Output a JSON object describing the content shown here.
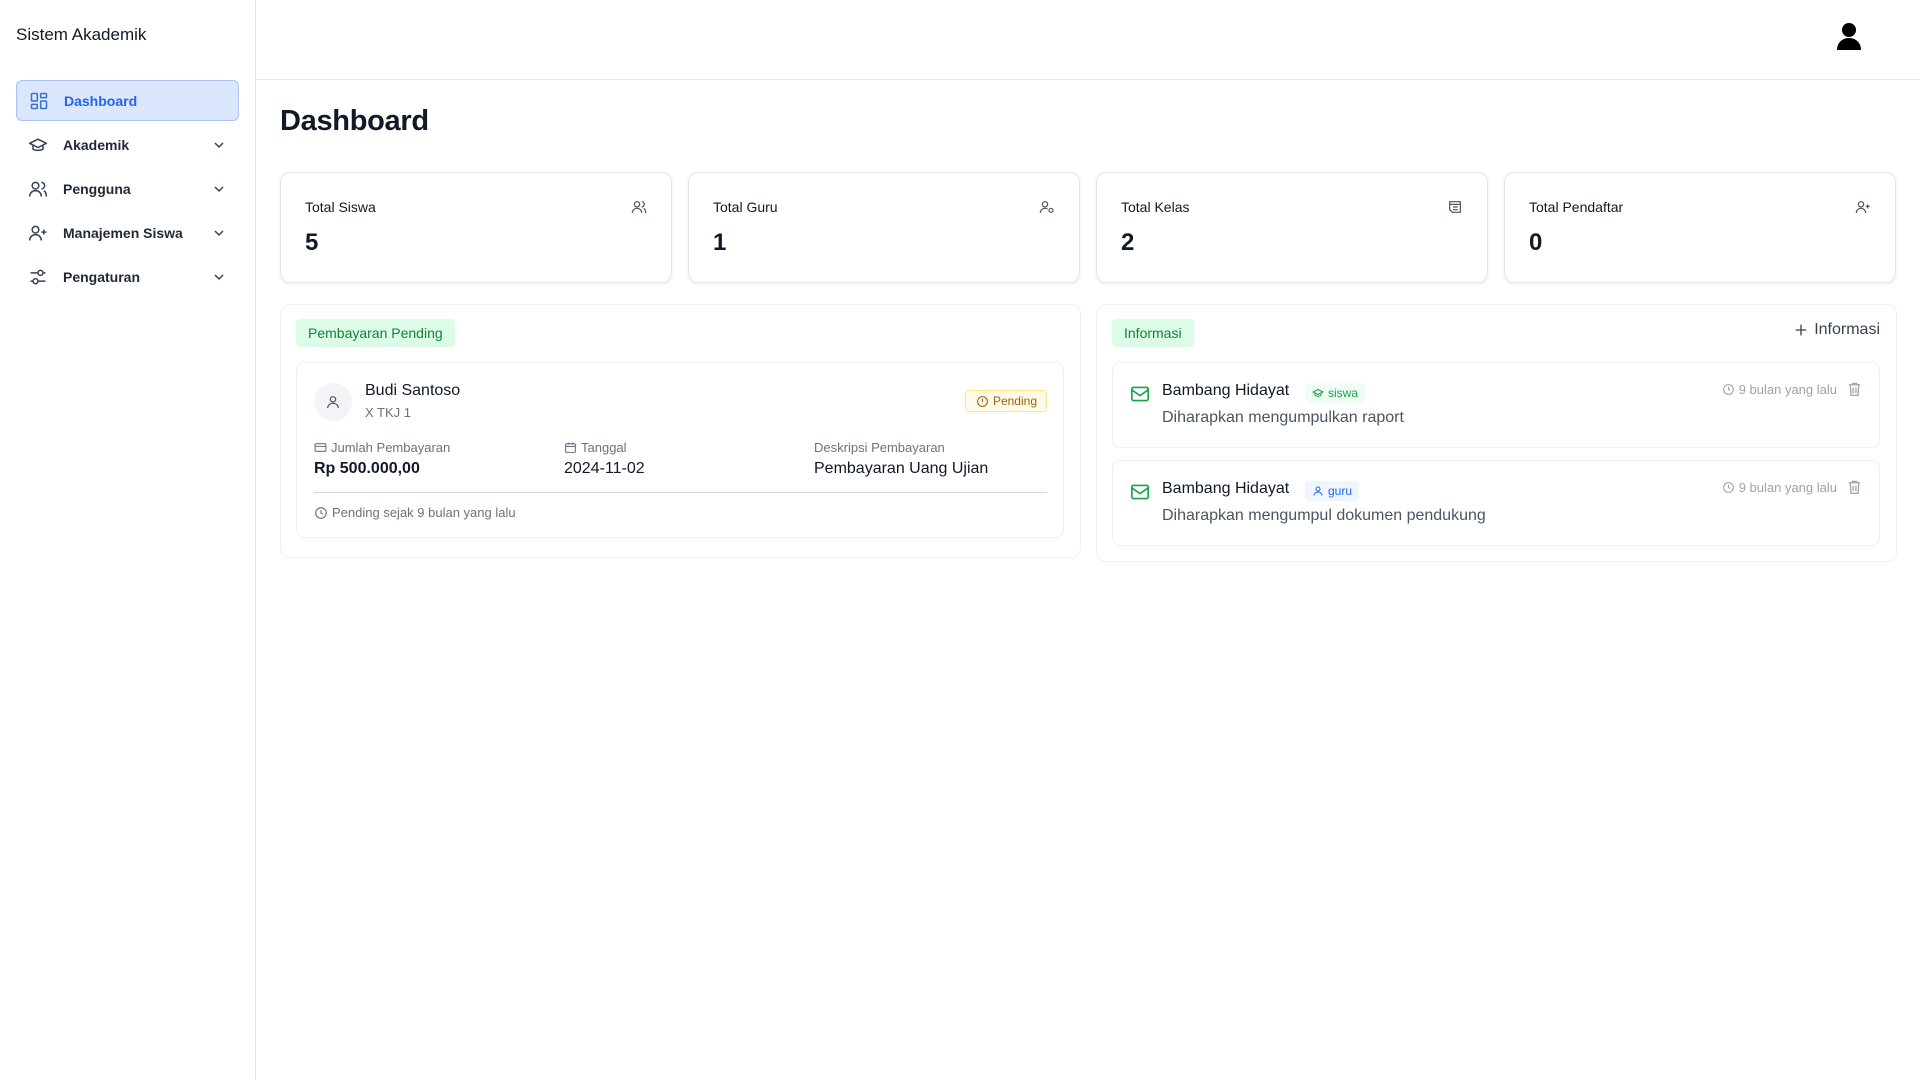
{
  "sidebar": {
    "brand": "Sistem Akademik",
    "items": [
      {
        "label": "Dashboard",
        "icon": "dashboard-grid-icon",
        "active": true
      },
      {
        "label": "Akademik",
        "icon": "graduation-cap-icon"
      },
      {
        "label": "Pengguna",
        "icon": "users-icon"
      },
      {
        "label": "Manajemen Siswa",
        "icon": "user-plus-icon"
      },
      {
        "label": "Pengaturan",
        "icon": "settings-sliders-icon"
      }
    ]
  },
  "header": {
    "user_icon": "user-avatar-icon"
  },
  "page": {
    "title": "Dashboard"
  },
  "stats": [
    {
      "label": "Total Siswa",
      "value": "5",
      "icon": "users-icon"
    },
    {
      "label": "Total Guru",
      "value": "1",
      "icon": "user-cog-icon"
    },
    {
      "label": "Total Kelas",
      "value": "2",
      "icon": "school-icon"
    },
    {
      "label": "Total Pendaftar",
      "value": "0",
      "icon": "user-plus-icon"
    }
  ],
  "payments": {
    "tag": "Pembayaran Pending",
    "items": [
      {
        "name": "Budi Santoso",
        "class": "X TKJ 1",
        "status": "Pending",
        "amount_label": "Jumlah Pembayaran",
        "amount": "Rp 500.000,00",
        "date_label": "Tanggal",
        "date": "2024-11-02",
        "desc_label": "Deskripsi Pembayaran",
        "desc": "Pembayaran Uang Ujian",
        "footer": "Pending sejak 9 bulan yang lalu"
      }
    ]
  },
  "info": {
    "tag": "Informasi",
    "add_label": "Informasi",
    "items": [
      {
        "sender": "Bambang Hidayat",
        "role": "siswa",
        "message": "Diharapkan mengumpulkan raport",
        "time": "9 bulan yang lalu"
      },
      {
        "sender": "Bambang Hidayat",
        "role": "guru",
        "message": "Diharapkan mengumpul dokumen pendukung",
        "time": "9 bulan yang lalu"
      }
    ]
  },
  "colors": {
    "accent": "#2563eb",
    "active_bg": "#dbe7fd",
    "success": "#16a34a",
    "tag_bg": "#dcfce7",
    "warning": "#a16207"
  }
}
